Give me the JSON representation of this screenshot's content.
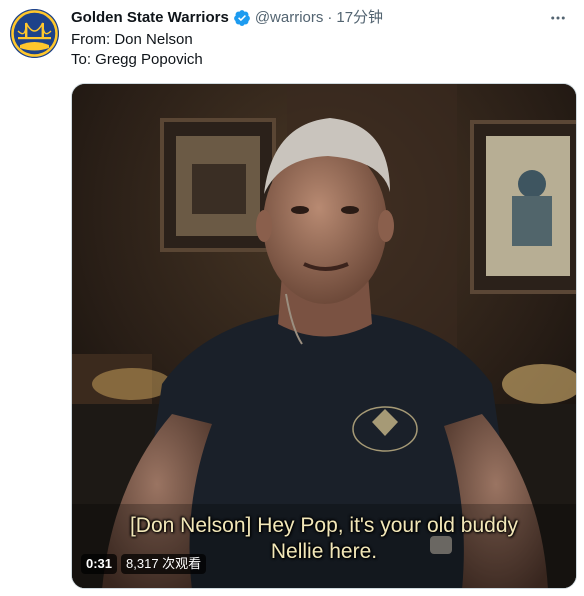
{
  "account": {
    "display_name": "Golden State Warriors",
    "handle": "@warriors",
    "separator": "·",
    "timestamp": "17分钟",
    "verified_color": "#1d9bf0",
    "avatar_bg": "#1d428a",
    "avatar_accent": "#ffc72c"
  },
  "tweet": {
    "line1": "From: Don Nelson",
    "line2": "To: Gregg Popovich"
  },
  "video": {
    "subtitle_line1": "[Don Nelson] Hey Pop, it's your old buddy",
    "subtitle_line2": "Nellie here.",
    "duration": "0:31",
    "views": "8,317 次观看"
  },
  "icons": {
    "more": "more-horizontal-icon",
    "verified": "verified-badge-icon",
    "avatar": "warriors-bridge-logo"
  }
}
